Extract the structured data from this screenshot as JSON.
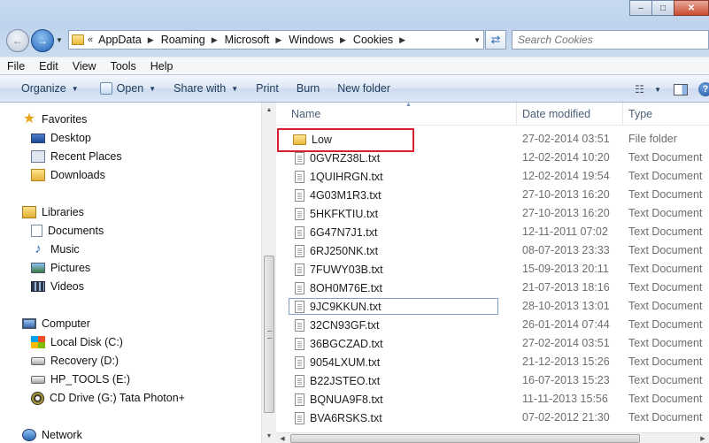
{
  "address": {
    "overflow": "«",
    "crumbs": [
      "AppData",
      "Roaming",
      "Microsoft",
      "Windows",
      "Cookies"
    ]
  },
  "search": {
    "placeholder": "Search Cookies"
  },
  "menu": [
    "File",
    "Edit",
    "View",
    "Tools",
    "Help"
  ],
  "toolbar": {
    "organize": "Organize",
    "open": "Open",
    "share_with": "Share with",
    "print": "Print",
    "burn": "Burn",
    "new_folder": "New folder"
  },
  "nav": {
    "favorites": "Favorites",
    "desktop": "Desktop",
    "recent_places": "Recent Places",
    "downloads": "Downloads",
    "libraries": "Libraries",
    "documents": "Documents",
    "music": "Music",
    "pictures": "Pictures",
    "videos": "Videos",
    "computer": "Computer",
    "local_disk": "Local Disk (C:)",
    "recovery": "Recovery (D:)",
    "hp_tools": "HP_TOOLS (E:)",
    "cd_drive": "CD Drive (G:) Tata Photon+",
    "network": "Network"
  },
  "columns": {
    "name": "Name",
    "date_modified": "Date modified",
    "type": "Type"
  },
  "files": [
    {
      "name": "Low",
      "date": "27-02-2014 03:51",
      "type": "File folder",
      "kind": "folder"
    },
    {
      "name": "0GVRZ38L.txt",
      "date": "12-02-2014 10:20",
      "type": "Text Document",
      "kind": "text"
    },
    {
      "name": "1QUIHRGN.txt",
      "date": "12-02-2014 19:54",
      "type": "Text Document",
      "kind": "text"
    },
    {
      "name": "4G03M1R3.txt",
      "date": "27-10-2013 16:20",
      "type": "Text Document",
      "kind": "text"
    },
    {
      "name": "5HKFKTIU.txt",
      "date": "27-10-2013 16:20",
      "type": "Text Document",
      "kind": "text"
    },
    {
      "name": "6G47N7J1.txt",
      "date": "12-11-2011 07:02",
      "type": "Text Document",
      "kind": "text"
    },
    {
      "name": "6RJ250NK.txt",
      "date": "08-07-2013 23:33",
      "type": "Text Document",
      "kind": "text"
    },
    {
      "name": "7FUWY03B.txt",
      "date": "15-09-2013 20:11",
      "type": "Text Document",
      "kind": "text"
    },
    {
      "name": "8OH0M76E.txt",
      "date": "21-07-2013 18:16",
      "type": "Text Document",
      "kind": "text"
    },
    {
      "name": "9JC9KKUN.txt",
      "date": "28-10-2013 13:01",
      "type": "Text Document",
      "kind": "text"
    },
    {
      "name": "32CN93GF.txt",
      "date": "26-01-2014 07:44",
      "type": "Text Document",
      "kind": "text"
    },
    {
      "name": "36BGCZAD.txt",
      "date": "27-02-2014 03:51",
      "type": "Text Document",
      "kind": "text"
    },
    {
      "name": "9054LXUM.txt",
      "date": "21-12-2013 15:26",
      "type": "Text Document",
      "kind": "text"
    },
    {
      "name": "B22JSTEO.txt",
      "date": "16-07-2013 15:23",
      "type": "Text Document",
      "kind": "text"
    },
    {
      "name": "BQNUA9F8.txt",
      "date": "11-11-2013 15:56",
      "type": "Text Document",
      "kind": "text"
    },
    {
      "name": "BVA6RSKS.txt",
      "date": "07-02-2012 21:30",
      "type": "Text Document",
      "kind": "text"
    }
  ],
  "focused_index": 9,
  "highlighted_index": 0,
  "colors": {
    "highlight": "#d7202b",
    "toolbar_text": "#1e395b"
  }
}
